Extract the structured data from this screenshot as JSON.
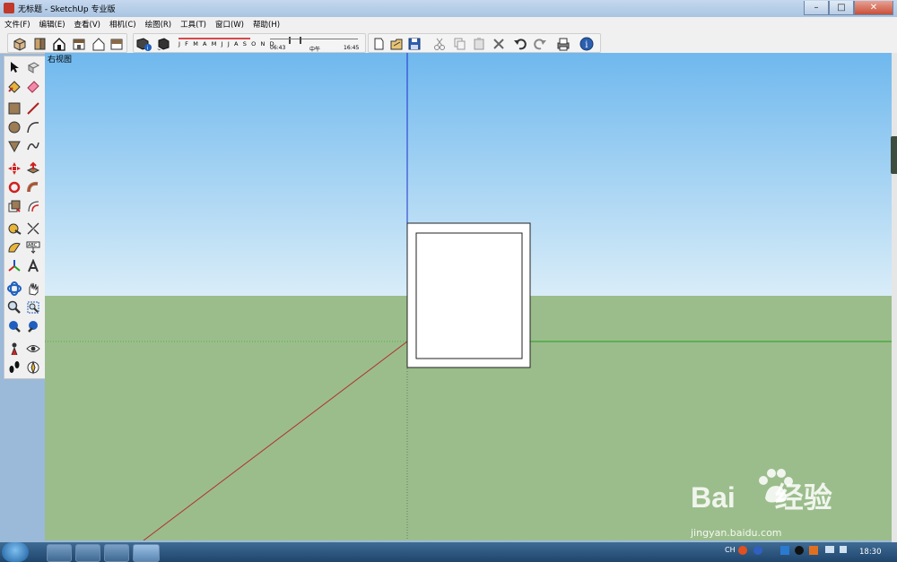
{
  "window": {
    "title": "无标题 - SketchUp 专业版",
    "controls": {
      "minimize": "–",
      "maximize": "□",
      "close": "✕"
    }
  },
  "menubar": {
    "items": [
      {
        "label": "文件(F)"
      },
      {
        "label": "编辑(E)"
      },
      {
        "label": "查看(V)"
      },
      {
        "label": "相机(C)"
      },
      {
        "label": "绘图(R)"
      },
      {
        "label": "工具(T)"
      },
      {
        "label": "窗口(W)"
      },
      {
        "label": "帮助(H)"
      }
    ]
  },
  "shadow": {
    "months": "J F M A M J J A S O N D",
    "time_start": "06:43",
    "time_mid": "中午",
    "time_end": "16:45"
  },
  "viewport": {
    "view_label": "右视图",
    "sky_color": "#6fb8ee",
    "ground_color": "#9bbd8b"
  },
  "watermark": {
    "brand": "Bai",
    "brand_suffix": "经验",
    "url": "jingyan.baidu.com"
  },
  "taskbar": {
    "lang": "CH",
    "clock": "18:30"
  }
}
